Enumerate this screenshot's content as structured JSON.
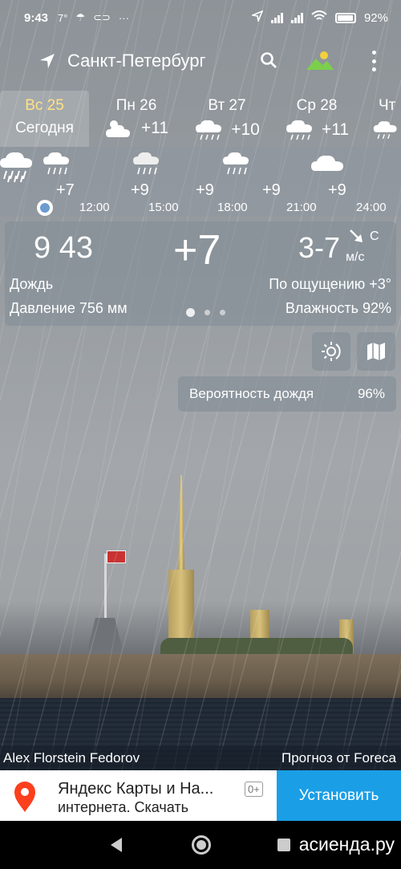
{
  "status_bar": {
    "time": "9:43",
    "temp": "7°",
    "battery": "92%",
    "icons": [
      "umbrella-icon",
      "link-icon",
      "more-icon",
      "location-arrow-icon",
      "signal-icon",
      "wifi-icon",
      "battery-icon"
    ]
  },
  "header": {
    "city": "Санкт-Петербург"
  },
  "days": [
    {
      "name": "Вс 25",
      "sub": "Сегодня",
      "today": true
    },
    {
      "name": "Пн 26",
      "temp": "+11",
      "icon": "partly-cloudy-icon"
    },
    {
      "name": "Вт 27",
      "temp": "+10",
      "icon": "rain-cloud-icon"
    },
    {
      "name": "Ср 28",
      "temp": "+11",
      "icon": "rain-cloud-icon"
    },
    {
      "name": "Чт",
      "icon": "rain-cloud-icon"
    }
  ],
  "hourly": {
    "temps": [
      "+7",
      "+9",
      "+9",
      "+9",
      "+9"
    ],
    "times": [
      "12:00",
      "15:00",
      "18:00",
      "21:00",
      "24:00"
    ]
  },
  "current": {
    "time": "9 43",
    "temp": "+7",
    "wind": "3-7",
    "wind_dir": "С",
    "wind_unit": "м/с",
    "condition": "Дождь",
    "feels_like": "По ощущению +3°",
    "pressure": "Давление 756 мм",
    "humidity": "Влажность 92%",
    "page_dots": 3,
    "active_dot": 0
  },
  "rain_probability": {
    "label": "Вероятность дождя",
    "value": "96%"
  },
  "credits": {
    "photo": "Alex Florstein Fedorov",
    "source": "Прогноз от Foreca"
  },
  "ad": {
    "title": "Яндекс Карты и На...",
    "subtitle": "интернета. Скачать",
    "age": "0+",
    "button": "Установить"
  },
  "watermark": "асиенда.ру",
  "colors": {
    "today_highlight": "#ffe184",
    "ad_button": "#1a9ee6",
    "now_dot": "#6d9bd0"
  }
}
